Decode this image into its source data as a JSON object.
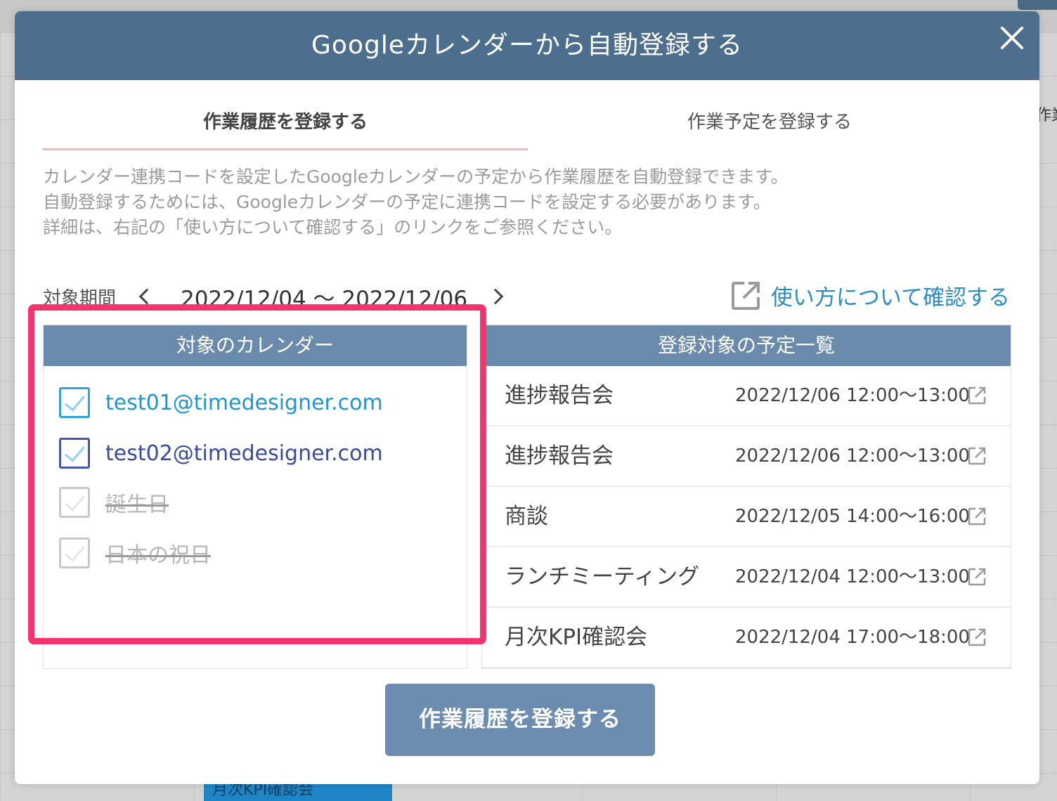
{
  "background": {
    "peek_text": "作業",
    "event_label": "月次KPI確認会"
  },
  "modal": {
    "title": "Googleカレンダーから自動登録する",
    "close_icon": "close-icon",
    "tabs": [
      {
        "label": "作業履歴を登録する",
        "active": true
      },
      {
        "label": "作業予定を登録する",
        "active": false
      }
    ],
    "description": [
      "カレンダー連携コードを設定したGoogleカレンダーの予定から作業履歴を自動登録できます。",
      "自動登録するためには、Googleカレンダーの予定に連携コードを設定する必要があります。",
      "詳細は、右記の「使い方について確認する」のリンクをご参照ください。"
    ],
    "period": {
      "label": "対象期間",
      "range": "2022/12/04 〜 2022/12/06",
      "prev_icon": "chevron-left-icon",
      "next_icon": "chevron-right-icon"
    },
    "help_link": {
      "label": "使い方について確認する",
      "icon": "external-link-icon"
    },
    "calendars": {
      "header": "対象のカレンダー",
      "items": [
        {
          "name": "test01@timedesigner.com",
          "checked": true,
          "enabled": true,
          "color": "#2fa3e0"
        },
        {
          "name": "test02@timedesigner.com",
          "checked": true,
          "enabled": true,
          "color": "#4356b0"
        },
        {
          "name": "誕生日",
          "checked": false,
          "enabled": false
        },
        {
          "name": "日本の祝日",
          "checked": false,
          "enabled": false
        }
      ]
    },
    "events": {
      "header": "登録対象の予定一覧",
      "items": [
        {
          "title": "進捗報告会",
          "time": "2022/12/06 12:00〜13:00"
        },
        {
          "title": "進捗報告会",
          "time": "2022/12/06 12:00〜13:00"
        },
        {
          "title": "商談",
          "time": "2022/12/05 14:00〜16:00"
        },
        {
          "title": "ランチミーティング",
          "time": "2022/12/04 12:00〜13:00"
        },
        {
          "title": "月次KPI確認会",
          "time": "2022/12/04 17:00〜18:00"
        }
      ]
    },
    "submit_label": "作業履歴を登録する",
    "colors": {
      "header_bg": "#4d6f8d",
      "panel_head_bg": "#6a8bab",
      "link": "#2b8ccc",
      "highlight": "#f5336c",
      "button_bg": "#6c8daf"
    }
  }
}
